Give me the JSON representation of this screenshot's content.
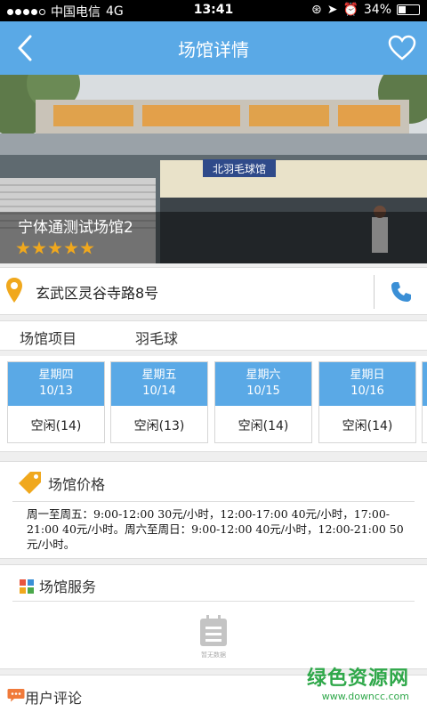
{
  "statusbar": {
    "carrier": "中国电信",
    "network": "4G",
    "time": "13:41",
    "battery": "34%"
  },
  "header": {
    "title": "场馆详情",
    "back_icon": "chevron-left-icon",
    "favorite_icon": "heart-icon"
  },
  "venue": {
    "name": "宁体通测试场馆2",
    "rating": 5,
    "photo_sign": "北羽毛球馆",
    "address": "玄武区灵谷寺路8号"
  },
  "project": {
    "label": "场馆项目",
    "value": "羽毛球"
  },
  "days": [
    {
      "weekday": "星期四",
      "date": "10/13",
      "status": "空闲(14)"
    },
    {
      "weekday": "星期五",
      "date": "10/14",
      "status": "空闲(13)"
    },
    {
      "weekday": "星期六",
      "date": "10/15",
      "status": "空闲(14)"
    },
    {
      "weekday": "星期日",
      "date": "10/16",
      "status": "空闲(14)"
    }
  ],
  "price": {
    "title": "场馆价格",
    "text": "周一至周五：9:00-12:00 30元/小时，12:00-17:00 40元/小时，17:00-21:00 40元/小时。周六至周日：9:00-12:00 40元/小时，12:00-21:00 50元/小时。"
  },
  "service": {
    "title": "场馆服务",
    "empty_text": "暂无数据"
  },
  "review": {
    "title": "用户评论"
  },
  "watermark": {
    "main": "绿色资源网",
    "url": "www.downcc.com"
  },
  "colors": {
    "accent": "#5aa9e6",
    "star": "#f0a81d",
    "pin": "#f0a81d"
  }
}
